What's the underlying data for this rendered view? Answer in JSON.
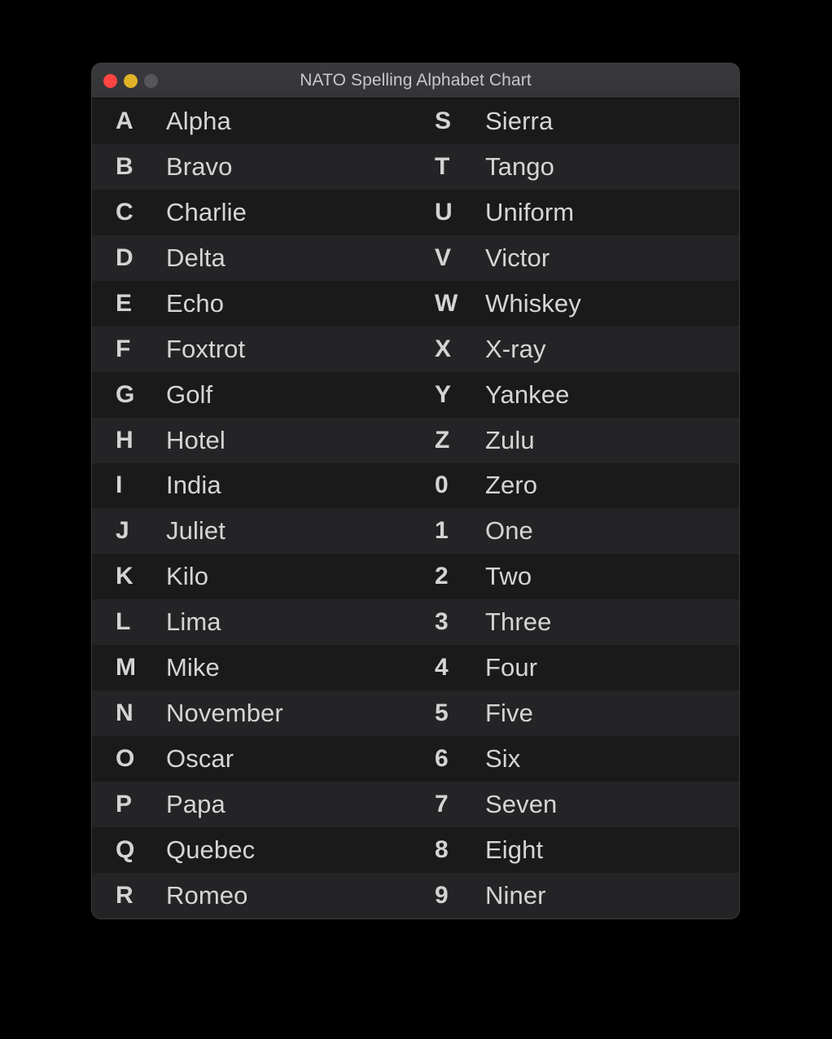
{
  "window": {
    "title": "NATO Spelling Alphabet Chart",
    "controls": {
      "close_label": "",
      "minimize_label": "",
      "zoom_label": ""
    },
    "colors": {
      "close": "#ff4542",
      "minimize": "#e0b327",
      "zoom": "#565658",
      "titlebar": "#37373a",
      "row_odd": "#1a1a1a",
      "row_even": "#242426",
      "text": "#d5d5d5",
      "title_text": "#c8c8cc",
      "backdrop": "#000000"
    }
  },
  "chart": {
    "rows": [
      {
        "left_code": "A",
        "left_word": "Alpha",
        "right_code": "S",
        "right_word": "Sierra"
      },
      {
        "left_code": "B",
        "left_word": "Bravo",
        "right_code": "T",
        "right_word": "Tango"
      },
      {
        "left_code": "C",
        "left_word": "Charlie",
        "right_code": "U",
        "right_word": "Uniform"
      },
      {
        "left_code": "D",
        "left_word": "Delta",
        "right_code": "V",
        "right_word": "Victor"
      },
      {
        "left_code": "E",
        "left_word": "Echo",
        "right_code": "W",
        "right_word": "Whiskey"
      },
      {
        "left_code": "F",
        "left_word": "Foxtrot",
        "right_code": "X",
        "right_word": "X-ray"
      },
      {
        "left_code": "G",
        "left_word": "Golf",
        "right_code": "Y",
        "right_word": "Yankee"
      },
      {
        "left_code": "H",
        "left_word": "Hotel",
        "right_code": "Z",
        "right_word": "Zulu"
      },
      {
        "left_code": "I",
        "left_word": "India",
        "right_code": "0",
        "right_word": "Zero"
      },
      {
        "left_code": "J",
        "left_word": "Juliet",
        "right_code": "1",
        "right_word": "One"
      },
      {
        "left_code": "K",
        "left_word": "Kilo",
        "right_code": "2",
        "right_word": "Two"
      },
      {
        "left_code": "L",
        "left_word": "Lima",
        "right_code": "3",
        "right_word": "Three"
      },
      {
        "left_code": "M",
        "left_word": "Mike",
        "right_code": "4",
        "right_word": "Four"
      },
      {
        "left_code": "N",
        "left_word": "November",
        "right_code": "5",
        "right_word": "Five"
      },
      {
        "left_code": "O",
        "left_word": "Oscar",
        "right_code": "6",
        "right_word": "Six"
      },
      {
        "left_code": "P",
        "left_word": "Papa",
        "right_code": "7",
        "right_word": "Seven"
      },
      {
        "left_code": "Q",
        "left_word": "Quebec",
        "right_code": "8",
        "right_word": "Eight"
      },
      {
        "left_code": "R",
        "left_word": "Romeo",
        "right_code": "9",
        "right_word": "Niner"
      }
    ]
  }
}
